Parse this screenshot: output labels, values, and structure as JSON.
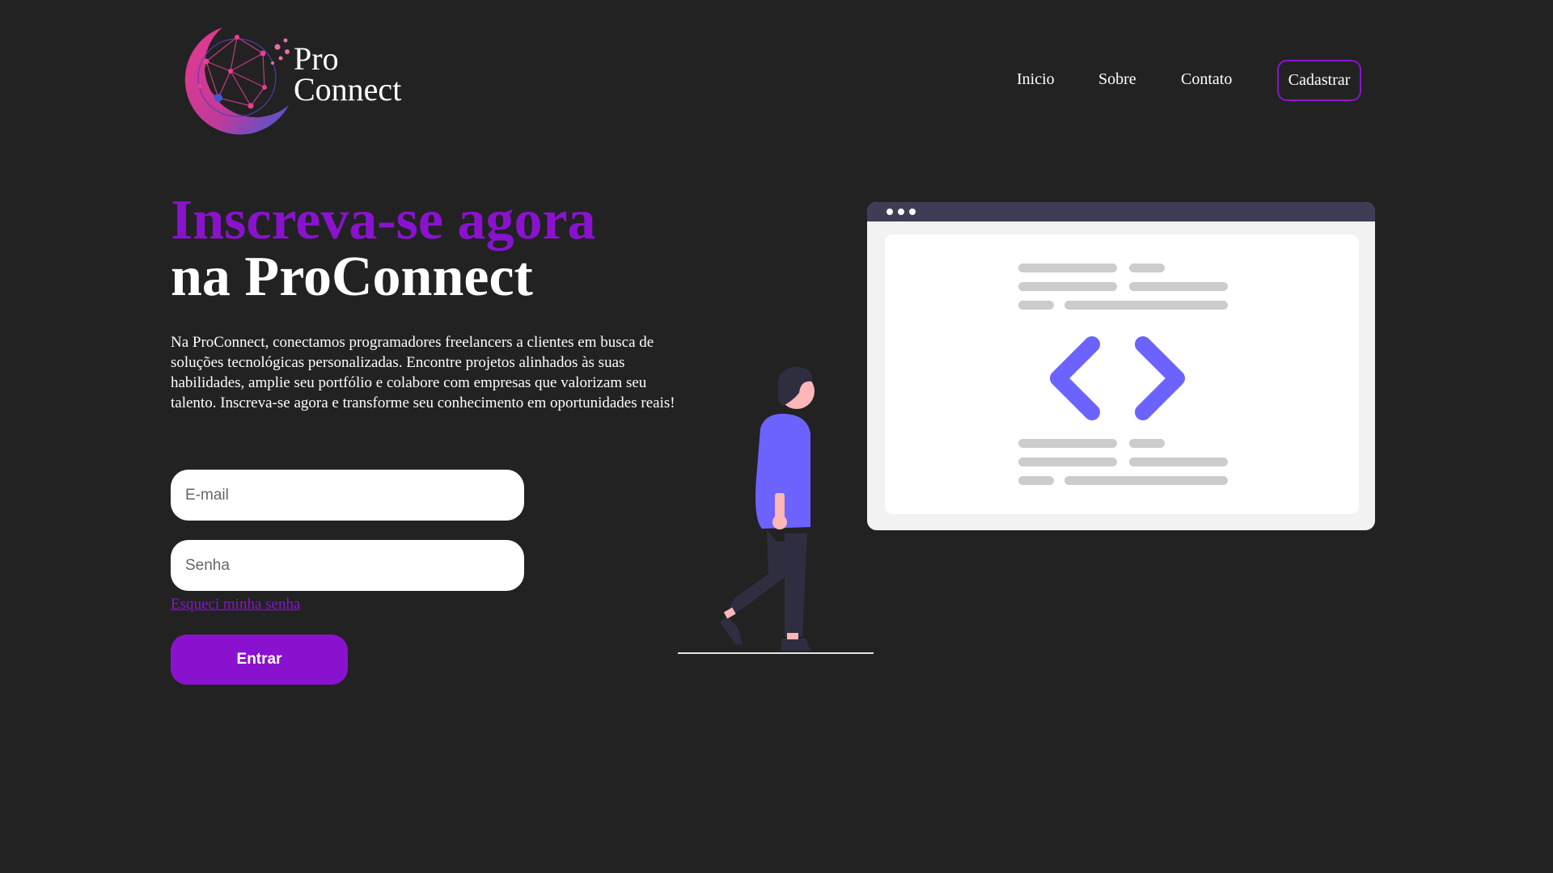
{
  "logo": {
    "line1": "Pro",
    "line2": "Connect"
  },
  "nav": {
    "inicio": "Inicio",
    "sobre": "Sobre",
    "contato": "Contato",
    "cadastrar": "Cadastrar"
  },
  "hero": {
    "title_line1": "Inscreva-se agora",
    "title_line2": "na ProConnect",
    "description": "Na ProConnect, conectamos programadores freelancers a clientes em busca de soluções tecnológicas personalizadas. Encontre projetos alinhados às suas habilidades, amplie seu portfólio e colabore com empresas que valorizam seu talento. Inscreva-se agora e transforme seu conhecimento em oportunidades reais!"
  },
  "form": {
    "email_placeholder": "E-mail",
    "password_placeholder": "Senha",
    "forgot_label": "Esqueci minha senha",
    "submit_label": "Entrar"
  },
  "colors": {
    "background": "#222222",
    "accent": "#8a12cf",
    "illustration_accent": "#6c63ff"
  },
  "icons": {
    "logo": "globe-network-logo",
    "illustration": "person-code-window-illustration"
  }
}
